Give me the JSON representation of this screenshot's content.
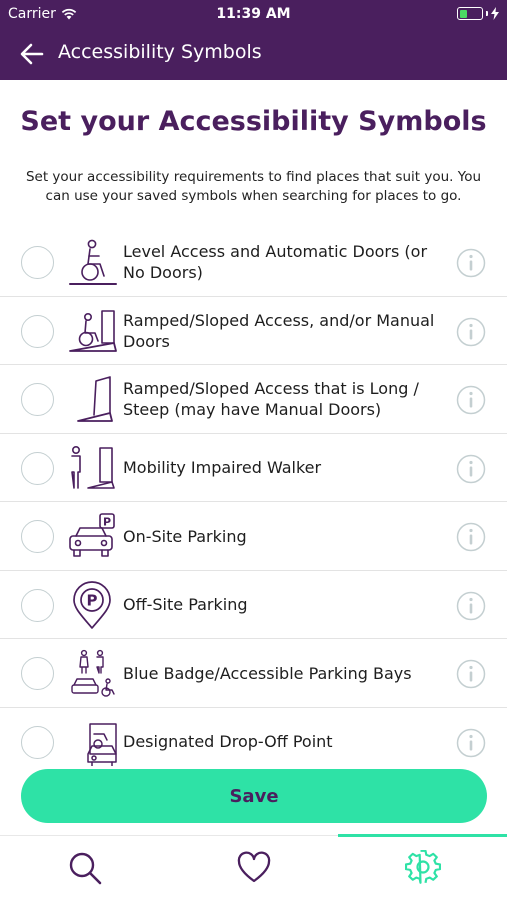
{
  "status": {
    "carrier": "Carrier",
    "time": "11:39 AM",
    "battery_level": 0.45
  },
  "nav": {
    "title": "Accessibility Symbols",
    "back_icon": "back-arrow-icon"
  },
  "heading": "Set your Accessibility Symbols",
  "intro": "Set your accessibility requirements to find places that suit you. You can use your saved symbols when searching for places to go.",
  "symbols": [
    {
      "label": "Level Access and Automatic Doors (or No Doors)",
      "icon": "wheelchair-level-access-icon"
    },
    {
      "label": "Ramped/Sloped Access, and/or Manual Doors",
      "icon": "wheelchair-ramp-icon"
    },
    {
      "label": "Ramped/Sloped Access that is Long / Steep (may have Manual Doors)",
      "icon": "steep-ramp-icon"
    },
    {
      "label": "Mobility Impaired Walker",
      "icon": "walker-icon"
    },
    {
      "label": "On-Site Parking",
      "icon": "car-parking-icon"
    },
    {
      "label": "Off-Site Parking",
      "icon": "parking-pin-icon"
    },
    {
      "label": "Blue Badge/Accessible Parking Bays",
      "icon": "blue-badge-parking-icon"
    },
    {
      "label": "Designated Drop-Off Point",
      "icon": "drop-off-point-icon"
    }
  ],
  "save_label": "Save",
  "tabs": [
    {
      "name": "search",
      "icon": "search-icon"
    },
    {
      "name": "favourites",
      "icon": "heart-icon"
    },
    {
      "name": "settings",
      "icon": "gear-icon",
      "active": true
    }
  ],
  "colors": {
    "brand": "#4a1f5e",
    "accent": "#2ee2a6",
    "radio_border": "#c4cfd1",
    "info": "#c4cfd1"
  }
}
